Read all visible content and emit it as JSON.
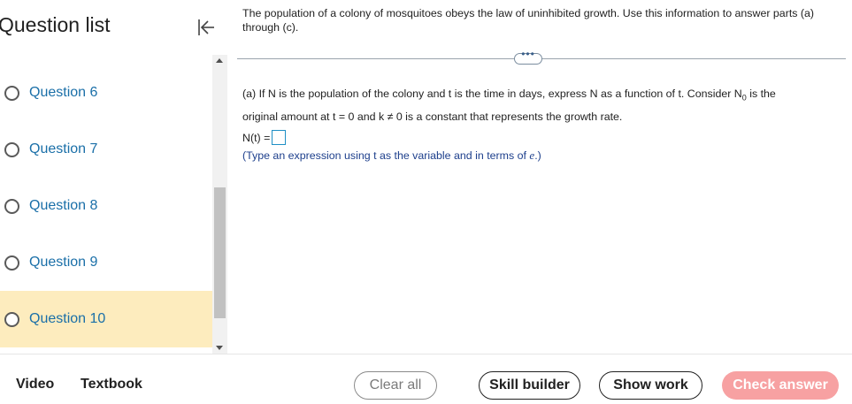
{
  "sidebar": {
    "title": "Question list",
    "questions": [
      {
        "label": "Question 6",
        "active": false
      },
      {
        "label": "Question 7",
        "active": false
      },
      {
        "label": "Question 8",
        "active": false
      },
      {
        "label": "Question 9",
        "active": false
      },
      {
        "label": "Question 10",
        "active": true
      }
    ]
  },
  "main": {
    "intro": "The population of a colony of mosquitoes obeys the law of uninhibited growth. Use this information to answer parts (a) through (c).",
    "more_label": "•••",
    "part_a_line1": "(a) If N is the population of the colony and t is the time in days, express N as a function of t. Consider N",
    "part_a_sub": "0",
    "part_a_line1_end": " is the",
    "part_a_line2": "original amount at t = 0 and k ≠ 0 is a constant that represents the growth rate.",
    "answer_label": "N(t) =",
    "answer_value": "",
    "hint_pre": "(Type an expression using t as the variable and in terms of ",
    "hint_e": "e",
    "hint_post": ".)"
  },
  "footer": {
    "video": "Video",
    "textbook": "Textbook",
    "clear_all": "Clear all",
    "skill_builder": "Skill builder",
    "show_work": "Show work",
    "check_answer": "Check answer"
  },
  "colors": {
    "accent_link": "#1a6fa8",
    "active_row": "#fdecbe",
    "check_button": "#f7a1a2",
    "answer_box_border": "#1f8fc5"
  },
  "icons": {
    "collapse": "collapse-left-icon",
    "radio": "radio-unchecked-icon"
  }
}
